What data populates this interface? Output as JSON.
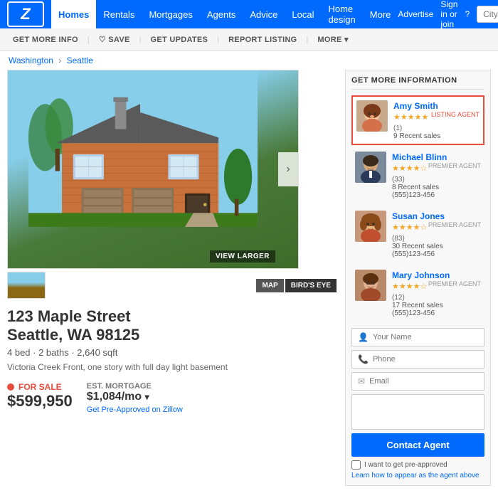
{
  "logo": {
    "text": "Z",
    "brand": "Zillow"
  },
  "nav": {
    "items": [
      {
        "label": "Homes",
        "active": true
      },
      {
        "label": "Rentals",
        "active": false
      },
      {
        "label": "Mortgages",
        "active": false
      },
      {
        "label": "Agents",
        "active": false
      },
      {
        "label": "Advice",
        "active": false
      },
      {
        "label": "Local",
        "active": false
      },
      {
        "label": "Home design",
        "active": false
      },
      {
        "label": "More",
        "active": false
      }
    ],
    "right": {
      "advertise": "Advertise",
      "sign_in": "Sign in or join",
      "help_icon": "?",
      "search_placeholder": "City, State, or Zip"
    }
  },
  "sub_nav": {
    "items": [
      {
        "label": "GET MORE INFO"
      },
      {
        "label": "♡ SAVE"
      },
      {
        "label": "GET UPDATES"
      },
      {
        "label": "REPORT LISTING"
      },
      {
        "label": "MORE ▾"
      }
    ]
  },
  "breadcrumb": {
    "parts": [
      "Washington",
      "Seattle"
    ]
  },
  "property": {
    "address": "123 Maple Street",
    "city_state": "Seattle, WA 98125",
    "specs": "4 bed · 2 baths · 2,640 sqft",
    "description": "Victoria Creek Front, one story with full day light basement",
    "status": "FOR SALE",
    "price": "$599,950",
    "mortgage_label": "EST. MORTGAGE",
    "mortgage_value": "$1,084/mo",
    "mortgage_icon": "▾",
    "preapprove_text": "Get Pre-Approved on Zillow",
    "view_larger": "VIEW LARGER",
    "map_btn": "MAP",
    "birds_eye_btn": "BIRD'S EYE"
  },
  "right_panel": {
    "title": "GET MORE INFORMATION",
    "agents": [
      {
        "name": "Amy Smith",
        "badge": "LISTING AGENT",
        "badge_type": "listing",
        "stars": 5,
        "review_count": "(1)",
        "recent_sales": "9 Recent sales",
        "phone": "",
        "featured": true,
        "photo_color": "#c8864a"
      },
      {
        "name": "Michael Blinn",
        "badge": "PREMIER AGENT",
        "badge_type": "premier",
        "stars": 4,
        "review_count": "(33)",
        "recent_sales": "8 Recent sales",
        "phone": "(555)123-456",
        "featured": false,
        "photo_color": "#5a6a7a"
      },
      {
        "name": "Susan Jones",
        "badge": "PREMIER AGENT",
        "badge_type": "premier",
        "stars": 4,
        "review_count": "(83)",
        "recent_sales": "30 Recent sales",
        "phone": "(555)123-456",
        "featured": false,
        "photo_color": "#c8864a"
      },
      {
        "name": "Mary Johnson",
        "badge": "PREMIER AGENT",
        "badge_type": "premier",
        "stars": 4,
        "review_count": "(12)",
        "recent_sales": "17 Recent sales",
        "phone": "(555)123-456",
        "featured": false,
        "photo_color": "#b07850"
      }
    ],
    "form": {
      "name_placeholder": "Your Name",
      "phone_placeholder": "Phone",
      "email_placeholder": "Email",
      "contact_btn": "Contact Agent",
      "preapprove_label": "I want to get pre-approved",
      "learn_link": "Learn how to appear as the agent above"
    }
  },
  "colors": {
    "brand_blue": "#006aff",
    "red": "#e74c3c",
    "star_gold": "#f5a623"
  }
}
